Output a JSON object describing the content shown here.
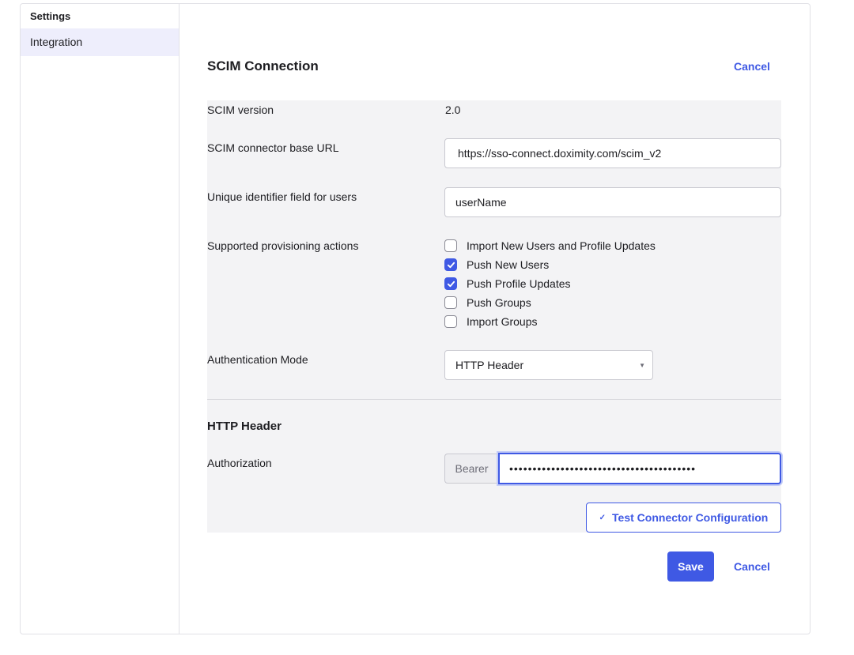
{
  "sidebar": {
    "heading": "Settings",
    "items": [
      {
        "label": "Integration"
      }
    ]
  },
  "section": {
    "title": "SCIM Connection",
    "cancel_label": "Cancel"
  },
  "form": {
    "scim_version": {
      "label": "SCIM version",
      "value": "2.0"
    },
    "base_url": {
      "label": "SCIM connector base URL",
      "value": "https://sso-connect.doximity.com/scim_v2"
    },
    "unique_id": {
      "label": "Unique identifier field for users",
      "value": "userName"
    },
    "provisioning": {
      "label": "Supported provisioning actions",
      "options": [
        {
          "label": "Import New Users and Profile Updates",
          "checked": false
        },
        {
          "label": "Push New Users",
          "checked": true
        },
        {
          "label": "Push Profile Updates",
          "checked": true
        },
        {
          "label": "Push Groups",
          "checked": false
        },
        {
          "label": "Import Groups",
          "checked": false
        }
      ]
    },
    "auth_mode": {
      "label": "Authentication Mode",
      "value": "HTTP Header"
    }
  },
  "http_header": {
    "title": "HTTP Header",
    "authorization": {
      "label": "Authorization",
      "prefix": "Bearer",
      "value": "••••••••••••••••••••••••••••••••••••••••"
    },
    "test_button_label": "Test Connector Configuration"
  },
  "footer": {
    "save_label": "Save",
    "cancel_label": "Cancel"
  },
  "colors": {
    "accent": "#3f59e4",
    "form_background": "#f3f3f5",
    "sidebar_active": "#eeeefc"
  },
  "icons": {
    "checkbox_checked": "checkmark-icon",
    "select_caret": "caret-down-icon",
    "test_button": "check-icon"
  }
}
